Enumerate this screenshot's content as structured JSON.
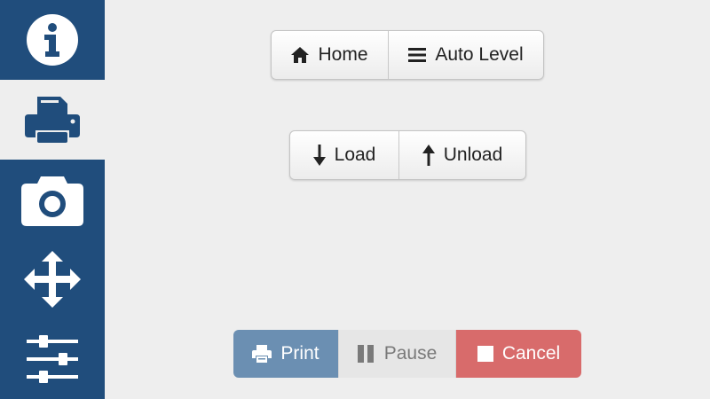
{
  "sidebar": {
    "items": [
      {
        "icon": "info-icon",
        "active": false
      },
      {
        "icon": "printer-icon",
        "active": true
      },
      {
        "icon": "camera-icon",
        "active": false
      },
      {
        "icon": "move-arrows-icon",
        "active": false
      },
      {
        "icon": "sliders-icon",
        "active": false
      }
    ]
  },
  "controls": {
    "home_label": "Home",
    "auto_level_label": "Auto Level",
    "load_label": "Load",
    "unload_label": "Unload"
  },
  "print_controls": {
    "print_label": "Print",
    "pause_label": "Pause",
    "cancel_label": "Cancel"
  },
  "colors": {
    "sidebar_bg": "#204d7c",
    "background": "#eeeeee",
    "print_button": "#6b8fb2",
    "pause_button": "#e6e6e6",
    "cancel_button": "#d86b6b"
  }
}
